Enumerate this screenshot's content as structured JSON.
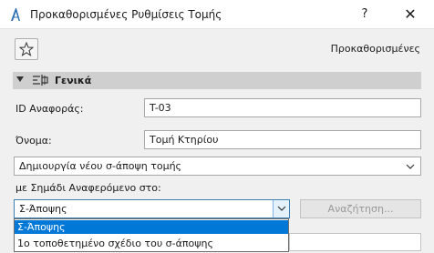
{
  "window": {
    "title": "Προκαθορισμένες Ρυθμίσεις Τομής",
    "help": "?",
    "close": "✕"
  },
  "toolbar": {
    "favorites_icon": "star-icon",
    "preset_label": "Προκαθορισμένες"
  },
  "section": {
    "title": "Γενικά"
  },
  "fields": {
    "ref_id_label": "ID Αναφοράς:",
    "ref_id_value": "T-03",
    "name_label": "Όνομα:",
    "name_value": "Τομή Κτηρίου",
    "create_select_value": "Δημιουργία νέου σ-άποψη τομής",
    "marker_ref_label": "με Σημάδι Αναφερόμενο στο:",
    "marker_ref_value": "Σ-Άποψης",
    "search_button": "Αναζήτηση..."
  },
  "dropdown": {
    "options": [
      "Σ-Άποψης",
      "1ο τοποθετημένο σχέδιο του σ-άποψης"
    ],
    "selected_index": 0
  },
  "colors": {
    "selection": "#0078d7",
    "section_header": "#cfcfcf"
  }
}
